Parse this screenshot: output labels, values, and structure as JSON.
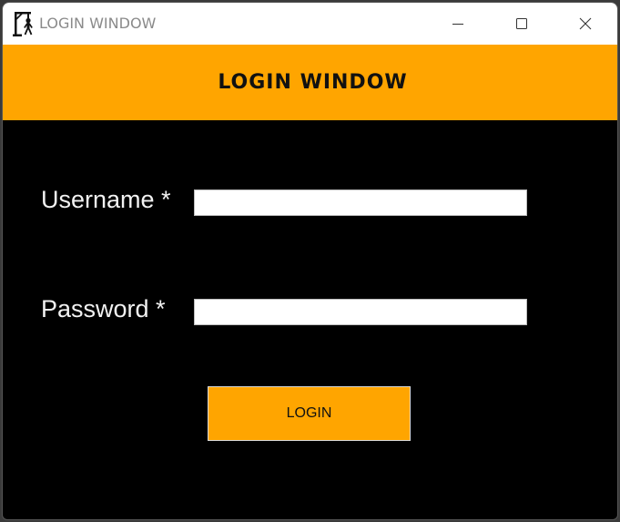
{
  "window": {
    "title": "LOGIN WINDOW",
    "app_icon": "hangman-icon",
    "controls": {
      "minimize": "minimize-icon",
      "maximize": "maximize-icon",
      "close": "close-icon"
    }
  },
  "header": {
    "title": "LOGIN WINDOW",
    "background_color": "#ffa500"
  },
  "form": {
    "username": {
      "label": "Username *",
      "value": "",
      "placeholder": ""
    },
    "password": {
      "label": "Password *",
      "value": "",
      "placeholder": ""
    },
    "submit_label": "LOGIN"
  },
  "colors": {
    "accent": "#ffa500",
    "background": "#000000",
    "label_text": "#f2f2f2"
  }
}
